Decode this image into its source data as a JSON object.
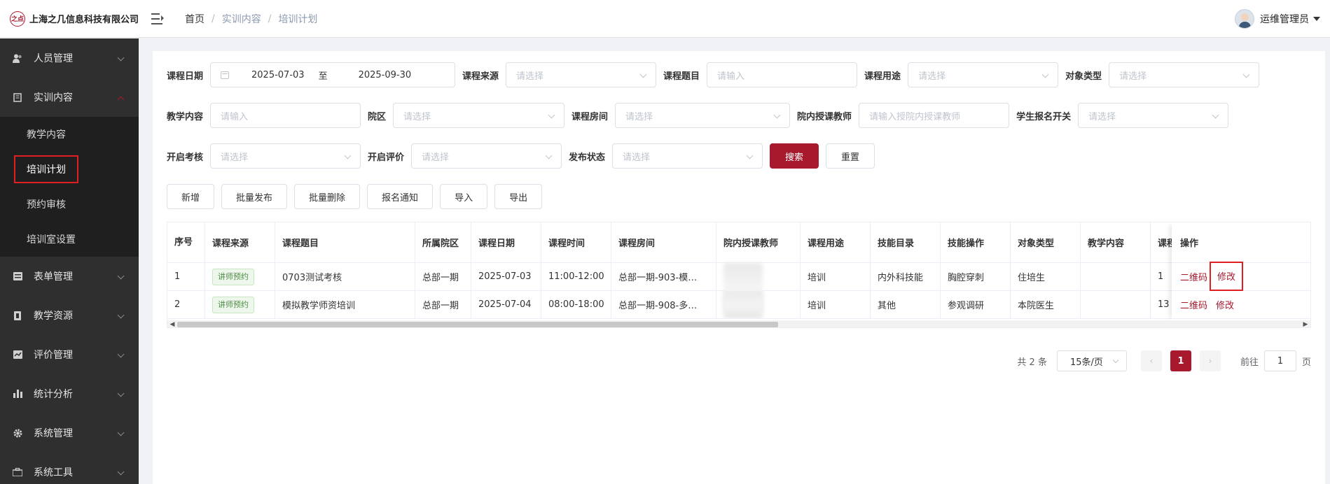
{
  "header": {
    "logo_mark": "之点",
    "company": "上海之几信息科技有限公司",
    "breadcrumb": [
      "首页",
      "实训内容",
      "培训计划"
    ],
    "user_name": "运维管理员"
  },
  "sidebar": {
    "items": [
      {
        "label": "人员管理",
        "icon": "people-icon"
      },
      {
        "label": "实训内容",
        "icon": "book-icon"
      },
      {
        "label": "表单管理",
        "icon": "form-icon"
      },
      {
        "label": "教学资源",
        "icon": "resource-icon"
      },
      {
        "label": "评价管理",
        "icon": "evaluation-icon"
      },
      {
        "label": "统计分析",
        "icon": "bar-chart-icon"
      },
      {
        "label": "系统管理",
        "icon": "gear-icon"
      },
      {
        "label": "系统工具",
        "icon": "toolbox-icon"
      }
    ],
    "sub_items": [
      "教学内容",
      "培训计划",
      "预约审核",
      "培训室设置"
    ]
  },
  "filters": {
    "course_date_label": "课程日期",
    "date_start": "2025-07-03",
    "date_sep": "至",
    "date_end": "2025-09-30",
    "course_source_label": "课程来源",
    "course_title_label": "课程题目",
    "course_usage_label": "课程用途",
    "target_type_label": "对象类型",
    "teaching_content_label": "教学内容",
    "campus_label": "院区",
    "room_label": "课程房间",
    "teacher_label": "院内授课教师",
    "signup_switch_label": "学生报名开关",
    "exam_label": "开启考核",
    "evaluation_label": "开启评价",
    "publish_label": "发布状态",
    "placeholder_select": "请选择",
    "placeholder_input": "请输入",
    "placeholder_teacher": "请输入授院内授课教师",
    "search_button": "搜索",
    "reset_button": "重置"
  },
  "toolbar": {
    "add": "新增",
    "batch_publish": "批量发布",
    "batch_delete": "批量删除",
    "signup_notice": "报名通知",
    "import": "导入",
    "export": "导出"
  },
  "table": {
    "headers": {
      "index": "序号",
      "source": "课程来源",
      "title": "课程题目",
      "campus": "所属院区",
      "date": "课程日期",
      "time": "课程时间",
      "room": "课程房间",
      "teacher": "院内授课教师",
      "usage": "课程用途",
      "skill_dir": "技能目录",
      "skill_op": "技能操作",
      "target": "对象类型",
      "content": "教学内容",
      "extra": "课程",
      "action": "操作"
    },
    "rows": [
      {
        "index": "1",
        "source": "讲师预约",
        "title": "0703测试考核",
        "campus": "总部一期",
        "date": "2025-07-03",
        "time": "11:00-12:00",
        "room": "总部一期-903-模…",
        "usage": "培训",
        "skill_dir": "内外科技能",
        "skill_op": "胸腔穿刺",
        "target": "住培生",
        "content": "",
        "extra": "1"
      },
      {
        "index": "2",
        "source": "讲师预约",
        "title": "模拟教学师资培训",
        "campus": "总部一期",
        "date": "2025-07-04",
        "time": "08:00-18:00",
        "room": "总部一期-908-多…",
        "usage": "培训",
        "skill_dir": "其他",
        "skill_op": "参观调研",
        "target": "本院医生",
        "content": "",
        "extra": "13"
      }
    ],
    "action_qrcode": "二维码",
    "action_edit": "修改"
  },
  "pagination": {
    "total": "共 2 条",
    "page_size": "15条/页",
    "current_page": "1",
    "goto_prefix": "前往",
    "goto_value": "1",
    "goto_suffix": "页"
  },
  "colors": {
    "brand": "#a8192e",
    "sidebar_bg": "#2f2f2f",
    "highlight_box": "#e02020"
  }
}
